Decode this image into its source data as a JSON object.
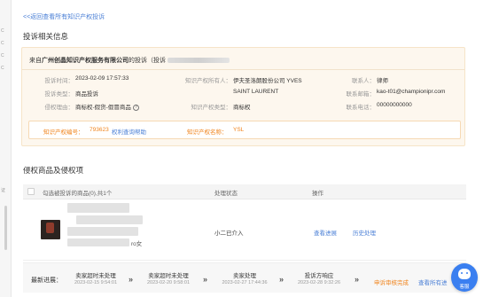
{
  "sidebar": {
    "labels": [
      "C",
      "C",
      "C",
      "C",
      "证"
    ]
  },
  "nav": {
    "back_link": "<<返回查看所有知识产权投诉"
  },
  "complaint": {
    "section_title": "投诉相关信息",
    "from_prefix": "来自",
    "company": "广州创晶知识产权服务有限公司",
    "complaint_suffix": "的投诉（投诉",
    "fields": {
      "time_label": "投诉时间：",
      "time_value": "2023-02-09 17:57:33",
      "owner_label": "知识产权所有人：",
      "owner_value_line1": "伊夫圣洛朗股份公司 YVES",
      "owner_value_line2": "SAINT LAURENT",
      "contact_label": "联系人：",
      "contact_value": "律师",
      "type_label": "投诉类型：",
      "type_value": "商品投诉",
      "email_label": "联系邮箱：",
      "email_value": "kao-t01@championipr.com",
      "reason_label": "侵权理由：",
      "reason_value": "商标权-假货-假冒商品",
      "ip_type_label": "知识产权类型：",
      "ip_type_value": "商标权",
      "phone_label": "联系电话：",
      "phone_value": "00000000000"
    },
    "ip": {
      "number_label": "知识产权编号：",
      "number_value": "793623",
      "detail_link": "权利查询帮助",
      "name_label": "知识产权名称：",
      "name_value": "YSL"
    }
  },
  "products": {
    "section_title": "侵权商品及侵权项",
    "columns": {
      "product": "勾选被投诉的商品(0),共1个",
      "status": "处理状态",
      "action": "操作"
    },
    "rows": [
      {
        "name_suffix": "ro女",
        "status": "小二已介入",
        "action_view": "查看进展",
        "action_history": "历史处理"
      }
    ]
  },
  "progress": {
    "title": "最新进展：",
    "steps": [
      {
        "name": "卖家超时未处理",
        "time": "2023-02-15 9:54:01"
      },
      {
        "name": "卖家超时未处理",
        "time": "2023-02-20 9:58:01"
      },
      {
        "name": "卖家处理",
        "time": "2023-02-27 17:44:36"
      },
      {
        "name": "投诉方响应",
        "time": "2023-02-28 9:32:26"
      }
    ],
    "status_text": "申诉审核完成",
    "view_all": "查看所有进"
  },
  "support": {
    "label": "客服"
  }
}
